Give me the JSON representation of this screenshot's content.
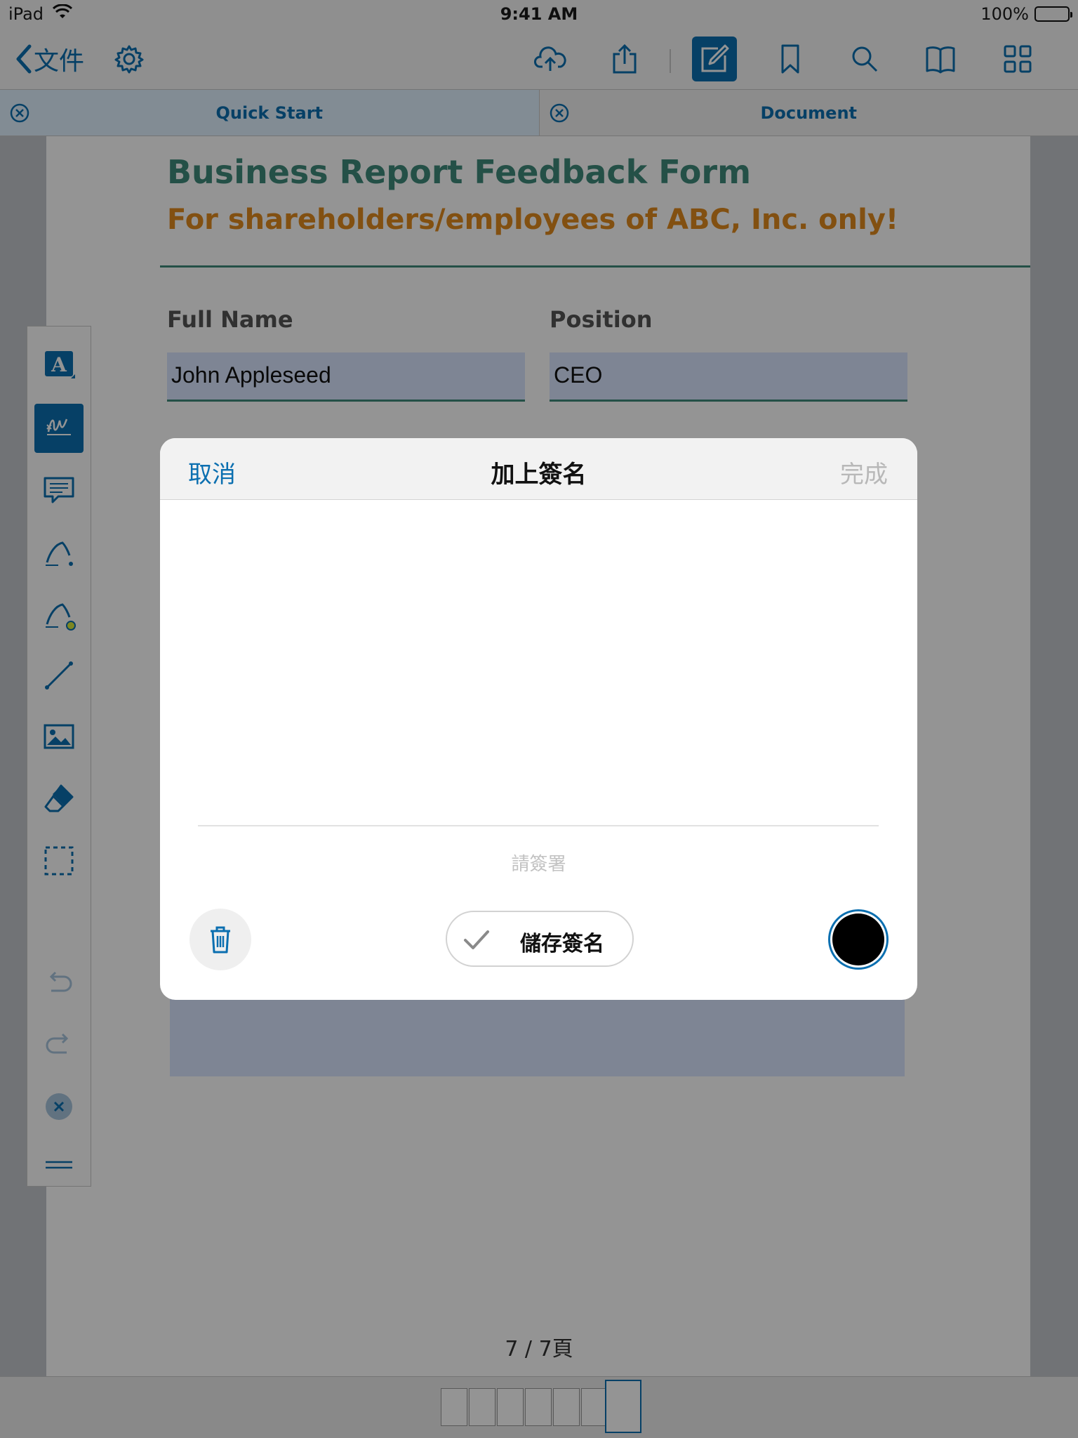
{
  "status_bar": {
    "device": "iPad",
    "time": "9:41 AM",
    "battery": "100%"
  },
  "nav": {
    "back_label": "文件"
  },
  "tabs": [
    {
      "label": "Quick Start",
      "active": true
    },
    {
      "label": "Document",
      "active": false
    }
  ],
  "document": {
    "title": "Business Report Feedback Form",
    "subtitle": "For shareholders/employees of ABC, Inc. only!",
    "fields": {
      "full_name_label": "Full Name",
      "full_name_value": "John Appleseed",
      "position_label": "Position",
      "position_value": "CEO"
    }
  },
  "page_indicator": "7 / 7頁",
  "modal": {
    "cancel": "取消",
    "title": "加上簽名",
    "done": "完成",
    "hint": "請簽署",
    "save_label": "儲存簽名",
    "ink_color": "#000000"
  },
  "colors": {
    "accent": "#0b6fb0",
    "doc_title": "#3f8a7a",
    "doc_subtitle": "#e08a1e"
  },
  "icons": {
    "nav": [
      "gear-icon",
      "cloud-upload-icon",
      "share-icon",
      "edit-annotation-icon",
      "bookmark-icon",
      "search-icon",
      "book-icon",
      "grid-icon"
    ],
    "toolbar": [
      "text-icon",
      "signature-icon",
      "comment-icon",
      "pen-icon",
      "highlighter-icon",
      "line-icon",
      "image-icon",
      "eraser-icon",
      "selection-icon",
      "undo-icon",
      "redo-icon",
      "close-icon",
      "menu-icon"
    ]
  },
  "thumbnails": {
    "count": 7,
    "current": 7
  }
}
